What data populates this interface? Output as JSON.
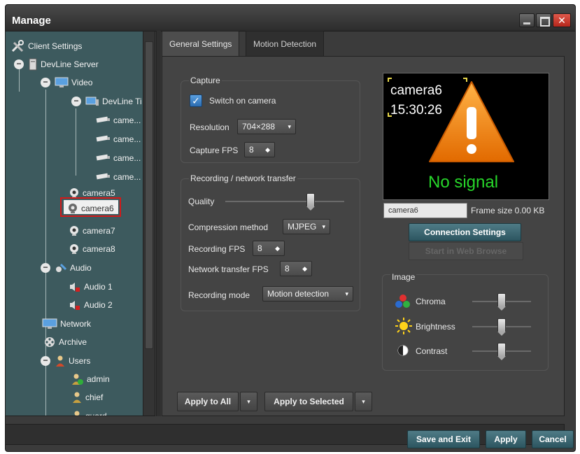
{
  "window": {
    "title": "Manage",
    "close_glyph": "✕"
  },
  "tree": {
    "items": [
      {
        "label": "Client Settings",
        "icon": "tools-icon"
      },
      {
        "label": "DevLine Server",
        "icon": "server-icon"
      },
      {
        "label": "Video",
        "icon": "monitor-icon"
      },
      {
        "label": "DevLine Ti",
        "icon": "video-server-icon"
      },
      {
        "label": "came...",
        "icon": "camera-icon"
      },
      {
        "label": "came...",
        "icon": "camera-icon"
      },
      {
        "label": "came...",
        "icon": "camera-icon"
      },
      {
        "label": "came...",
        "icon": "camera-icon"
      },
      {
        "label": "camera5",
        "icon": "webcam-icon"
      },
      {
        "label": "camera6",
        "icon": "webcam-icon",
        "selected": true
      },
      {
        "label": "camera7",
        "icon": "webcam-icon"
      },
      {
        "label": "camera8",
        "icon": "webcam-icon"
      },
      {
        "label": "Audio",
        "icon": "audio-icon"
      },
      {
        "label": "Audio 1",
        "icon": "speaker-icon"
      },
      {
        "label": "Audio 2",
        "icon": "speaker-icon"
      },
      {
        "label": "Network",
        "icon": "network-icon"
      },
      {
        "label": "Archive",
        "icon": "film-reel-icon"
      },
      {
        "label": "Users",
        "icon": "users-icon"
      },
      {
        "label": "admin",
        "icon": "admin-user-icon"
      },
      {
        "label": "chief",
        "icon": "user-icon"
      },
      {
        "label": "guard",
        "icon": "user-icon"
      }
    ],
    "expander_glyph": "−",
    "highlight_color": "#d21a1a"
  },
  "tabs": {
    "general": "General Settings",
    "motion": "Motion Detection"
  },
  "capture": {
    "title": "Capture",
    "switch_on_label": "Switch on camera",
    "switch_on_checked": true,
    "check_glyph": "✓",
    "resolution_label": "Resolution",
    "resolution_value": "704×288",
    "fps_label": "Capture FPS",
    "fps_value": "8"
  },
  "recording": {
    "title": "Recording / network transfer",
    "quality_label": "Quality",
    "quality_level": 0.72,
    "compression_label": "Compression method",
    "compression_value": "MJPEG",
    "rec_fps_label": "Recording FPS",
    "rec_fps_value": "8",
    "net_fps_label": "Network transfer FPS",
    "net_fps_value": "8",
    "mode_label": "Recording mode",
    "mode_value": "Motion detection"
  },
  "preview": {
    "camera_name": "camera6",
    "time": "15:30:26",
    "signal_text": "No signal",
    "signal_color": "#27d62a",
    "warning_icon": "warning-triangle-icon"
  },
  "camera_name_field": "camera6",
  "frame_size": "Frame size 0.00 KB",
  "connection_settings_label": "Connection Settings",
  "web_browse_label": "Start in Web Browse",
  "image": {
    "title": "Image",
    "chroma_label": "Chroma",
    "brightness_label": "Brightness",
    "contrast_label": "Contrast",
    "chroma_level": 0.5,
    "brightness_level": 0.5,
    "contrast_level": 0.5
  },
  "apply_to_all_label": "Apply to All",
  "apply_to_selected_label": "Apply to Selected",
  "save_exit_label": "Save and Exit",
  "apply_label": "Apply",
  "cancel_label": "Cancel",
  "dropdown_glyph": "▾",
  "spin_glyph": "◆",
  "accent_color": "#2c5560"
}
